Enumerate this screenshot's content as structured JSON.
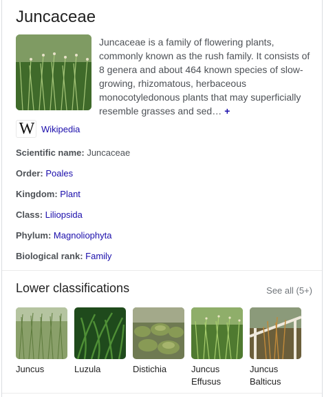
{
  "title": "Juncaceae",
  "description": "Juncaceae is a family of flowering plants, commonly known as the rush family. It consists of 8 genera and about 464 known species of slow-growing, rhizomatous, herbaceous monocotyledonous plants that may superficially resemble grasses and sed…",
  "more_icon": "plus-icon",
  "source": {
    "logo_text": "W",
    "label": "Wikipedia"
  },
  "facts": [
    {
      "key": "Scientific name:",
      "value": "Juncaceae",
      "link": false
    },
    {
      "key": "Order:",
      "value": "Poales",
      "link": true
    },
    {
      "key": "Kingdom:",
      "value": "Plant",
      "link": true
    },
    {
      "key": "Class:",
      "value": "Liliopsida",
      "link": true
    },
    {
      "key": "Phylum:",
      "value": "Magnoliophyta",
      "link": true
    },
    {
      "key": "Biological rank:",
      "value": "Family",
      "link": true
    }
  ],
  "lower_classifications": {
    "title": "Lower classifications",
    "see_all": "See all (5+)",
    "items": [
      {
        "line1": "Juncus",
        "line2": ""
      },
      {
        "line1": "Luzula",
        "line2": ""
      },
      {
        "line1": "Distichia",
        "line2": ""
      },
      {
        "line1": "Juncus",
        "line2": "Effusus"
      },
      {
        "line1": "Juncus",
        "line2": "Balticus"
      }
    ]
  },
  "colors": {
    "link": "#1a0dab",
    "text": "#4d5156",
    "muted": "#70757a"
  }
}
